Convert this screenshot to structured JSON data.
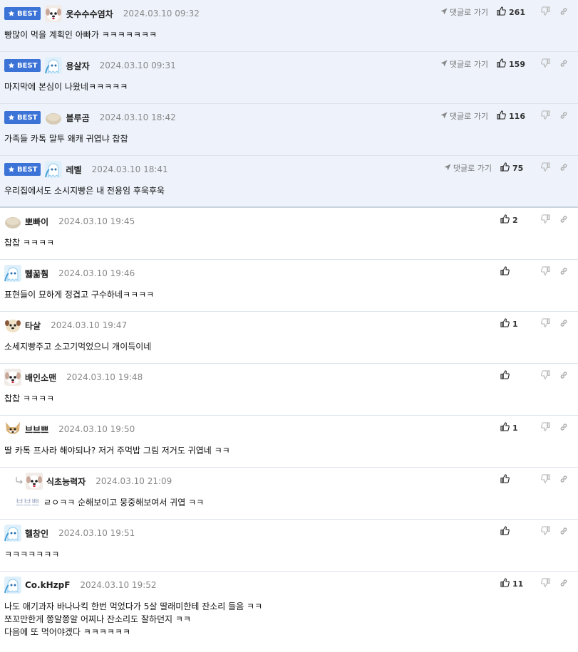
{
  "labels": {
    "best": "BEST",
    "goto_reply": "댓글로 가기"
  },
  "colors": {
    "accent": "#3b73d6",
    "best_bg": "#eef3fb"
  },
  "comments": [
    {
      "best": true,
      "avatar": "dog-white",
      "nick": "옷수수수염차",
      "date": "2024.03.10 09:32",
      "likes": "261",
      "text": "빵많이 먹을 계획인 아빠가 ㅋㅋㅋㅋㅋㅋㅋ"
    },
    {
      "best": true,
      "avatar": "ghost-blue",
      "nick": "용살자",
      "date": "2024.03.10 09:31",
      "likes": "159",
      "text": "마지막에 본심이 나왔네ㅋㅋㅋㅋㅋ"
    },
    {
      "best": true,
      "avatar": "blob-beige",
      "nick": "블루곰",
      "date": "2024.03.10 18:42",
      "likes": "116",
      "text": "가족들 카톡 말투 왜캐 귀엽냐 찹찹"
    },
    {
      "best": true,
      "avatar": "ghost-blue",
      "nick": "레벨",
      "date": "2024.03.10 18:41",
      "likes": "75",
      "text": "우리집에서도 소시지빵은 내 전용임 후욱후욱"
    },
    {
      "best": false,
      "avatar": "blob-beige",
      "nick": "뽀빠이",
      "date": "2024.03.10 19:45",
      "likes": "2",
      "text": "찹찹 ㅋㅋㅋㅋ"
    },
    {
      "best": false,
      "avatar": "ghost-blue",
      "nick": "뛣꿃훰",
      "date": "2024.03.10 19:46",
      "likes": "",
      "text": "표현들이 묘하게 정겹고 구수하네ㅋㅋㅋㅋ"
    },
    {
      "best": false,
      "avatar": "dog-cream",
      "nick": "타살",
      "date": "2024.03.10 19:47",
      "likes": "1",
      "text": "소세지빵주고 소고기먹었으니 개이득이네"
    },
    {
      "best": false,
      "avatar": "dog-white",
      "nick": "배인소맨",
      "date": "2024.03.10 19:48",
      "likes": "",
      "text": "찹찹 ㅋㅋㅋㅋ"
    },
    {
      "best": false,
      "avatar": "dog-shiba",
      "nick": "브브쁘",
      "date": "2024.03.10 19:50",
      "likes": "1",
      "text": "딸 카톡 프사라 해야되나? 저거 주먹밥 그림 저거도 귀엽네 ㅋㅋ"
    },
    {
      "best": false,
      "reply": true,
      "avatar": "dog-white",
      "nick": "식초능력자",
      "date": "2024.03.10 21:09",
      "likes": "",
      "mention": "브브쁘",
      "text": "ㄹㅇㅋㅋ 순해보이고 뭉중해보여서 귀엽 ㅋㅋ"
    },
    {
      "best": false,
      "avatar": "ghost-blue",
      "nick": "헬창인",
      "date": "2024.03.10 19:51",
      "likes": "",
      "text": "ㅋㅋㅋㅋㅋㅋㅋ"
    },
    {
      "best": false,
      "last": true,
      "avatar": "ghost-blue",
      "nick": "Co.kHzpF",
      "date": "2024.03.10 19:52",
      "likes": "11",
      "text": "나도 애기과자 바나나킥 한번 먹었다가 5살 딸래미한테 잔소리 들음 ㅋㅋ\n쪼꼬만한게 쫑알쫑알 어찌나 잔소리도 잘하던지 ㅋㅋ\n다음에 또 먹어야겠다 ㅋㅋㅋㅋㅋㅋ"
    }
  ]
}
